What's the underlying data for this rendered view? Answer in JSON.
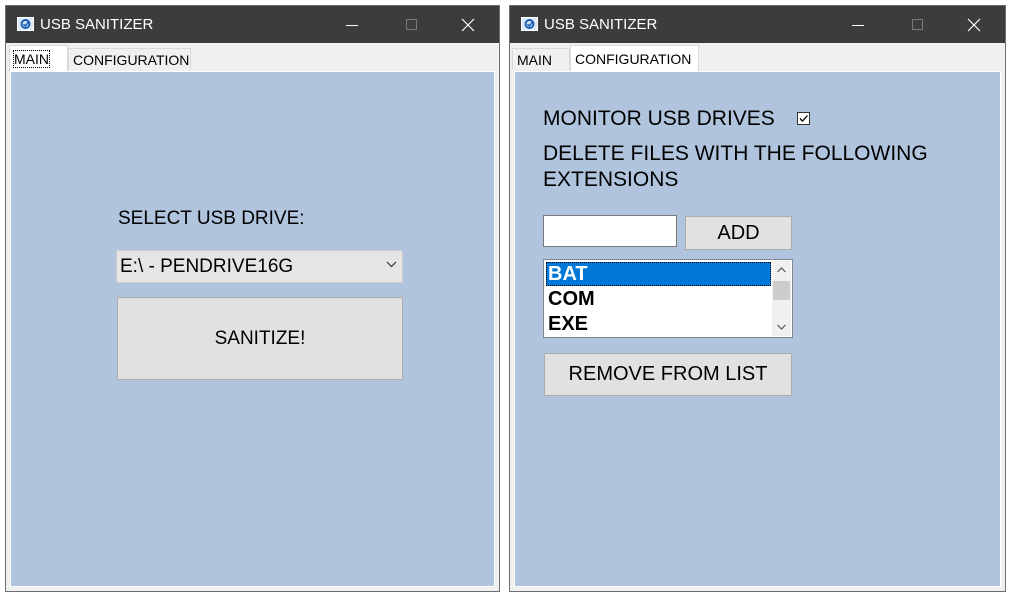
{
  "windows": {
    "main": {
      "title": "USB SANITIZER",
      "tabs": [
        "MAIN",
        "CONFIGURATION"
      ],
      "active_tab": "MAIN",
      "select_label": "SELECT USB DRIVE:",
      "drive_combo_value": "E:\\ - PENDRIVE16G",
      "sanitize_button": "SANITIZE!"
    },
    "config": {
      "title": "USB SANITIZER",
      "tabs": [
        "MAIN",
        "CONFIGURATION"
      ],
      "active_tab": "CONFIGURATION",
      "monitor_label": "MONITOR USB DRIVES",
      "monitor_checked": true,
      "delete_label_line1": "DELETE FILES WITH THE FOLLOWING",
      "delete_label_line2": "EXTENSIONS",
      "extension_input_value": "",
      "add_button": "ADD",
      "extensions": [
        "BAT",
        "COM",
        "EXE"
      ],
      "selected_extension": "BAT",
      "remove_button": "REMOVE FROM LIST"
    }
  },
  "colors": {
    "panel_bg": "#b0c4de",
    "titlebar_bg": "#3c3c3c",
    "selection": "#0078d7"
  },
  "icons": {
    "app": "usb-sanitizer-app-icon",
    "minimize": "minimize-icon",
    "maximize": "maximize-icon",
    "close": "close-icon",
    "dropdown": "chevron-down-icon",
    "checkbox": "checkmark-icon"
  }
}
